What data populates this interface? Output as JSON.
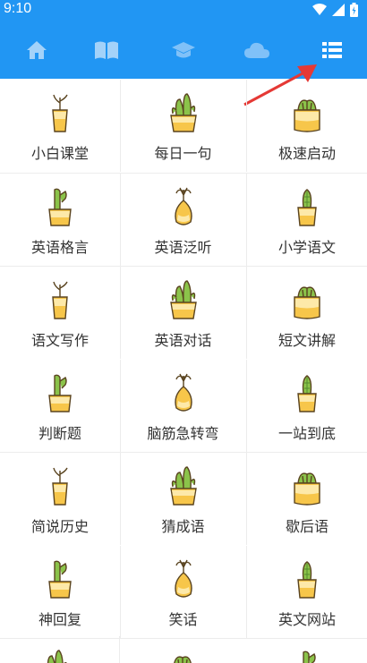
{
  "status_bar": {
    "time": "9:10"
  },
  "nav_tabs": [
    {
      "icon": "home-icon"
    },
    {
      "icon": "book-icon"
    },
    {
      "icon": "graduation-cap-icon"
    },
    {
      "icon": "cloud-icon"
    },
    {
      "icon": "list-icon"
    }
  ],
  "grid": [
    [
      "小白课堂",
      "每日一句",
      "极速启动"
    ],
    [
      "英语格言",
      "英语泛听",
      "小学语文"
    ],
    [
      "语文写作",
      "英语对话",
      "短文讲解"
    ],
    [
      "判断题",
      "脑筋急转弯",
      "一站到底"
    ],
    [
      "简说历史",
      "猜成语",
      "歇后语"
    ],
    [
      "神回复",
      "笑话",
      "英文网站"
    ]
  ],
  "colors": {
    "nav": "#2196F3",
    "accent_arrow": "#e53935",
    "pot": "#f7c64a",
    "plant": "#7cb342"
  }
}
